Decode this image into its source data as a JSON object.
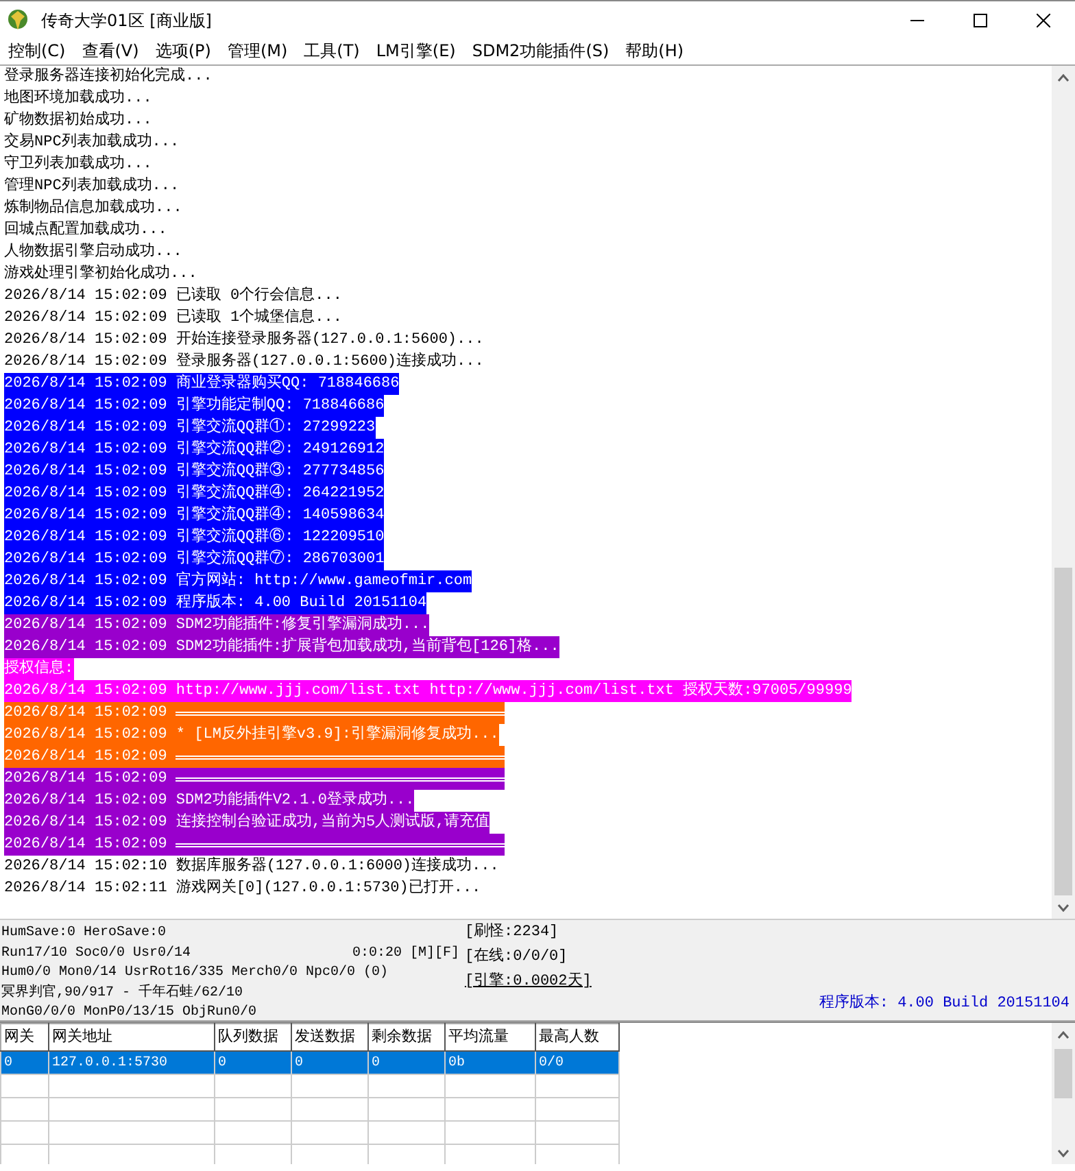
{
  "window": {
    "title": "传奇大学01区 [商业版]"
  },
  "menu": [
    {
      "label": "控制(C)"
    },
    {
      "label": "查看(V)"
    },
    {
      "label": "选项(P)"
    },
    {
      "label": "管理(M)"
    },
    {
      "label": "工具(T)"
    },
    {
      "label": "LM引擎(E)"
    },
    {
      "label": "SDM2功能插件(S)"
    },
    {
      "label": "帮助(H)"
    }
  ],
  "log": {
    "lines": [
      {
        "kind": "text",
        "text": "登录服务器连接初始化完成..."
      },
      {
        "kind": "text",
        "text": "地图环境加载成功..."
      },
      {
        "kind": "text",
        "text": "矿物数据初始成功..."
      },
      {
        "kind": "text",
        "text": "交易NPC列表加载成功..."
      },
      {
        "kind": "text",
        "text": "守卫列表加载成功..."
      },
      {
        "kind": "text",
        "text": "管理NPC列表加载成功..."
      },
      {
        "kind": "text",
        "text": "炼制物品信息加载成功..."
      },
      {
        "kind": "text",
        "text": "回城点配置加载成功..."
      },
      {
        "kind": "text",
        "text": "人物数据引擎启动成功..."
      },
      {
        "kind": "text",
        "text": "游戏处理引擎初始化成功..."
      },
      {
        "kind": "text",
        "text": "2026/8/14 15:02:09 已读取 0个行会信息..."
      },
      {
        "kind": "text",
        "text": "2026/8/14 15:02:09 已读取 1个城堡信息..."
      },
      {
        "kind": "text",
        "text": "2026/8/14 15:02:09 开始连接登录服务器(127.0.0.1:5600)..."
      },
      {
        "kind": "text",
        "text": "2026/8/14 15:02:09 登录服务器(127.0.0.1:5600)连接成功..."
      },
      {
        "kind": "text",
        "color": "#0000ff",
        "text": "2026/8/14 15:02:09 商业登录器购买QQ: 718846686"
      },
      {
        "kind": "text",
        "color": "#0000ff",
        "text": "2026/8/14 15:02:09 引擎功能定制QQ: 718846686"
      },
      {
        "kind": "text",
        "color": "#0000ff",
        "text": "2026/8/14 15:02:09 引擎交流QQ群①: 27299223"
      },
      {
        "kind": "text",
        "color": "#0000ff",
        "text": "2026/8/14 15:02:09 引擎交流QQ群②: 249126912"
      },
      {
        "kind": "text",
        "color": "#0000ff",
        "text": "2026/8/14 15:02:09 引擎交流QQ群③: 277734856"
      },
      {
        "kind": "text",
        "color": "#0000ff",
        "text": "2026/8/14 15:02:09 引擎交流QQ群④: 264221952"
      },
      {
        "kind": "text",
        "color": "#0000ff",
        "text": "2026/8/14 15:02:09 引擎交流QQ群④: 140598634"
      },
      {
        "kind": "text",
        "color": "#0000ff",
        "text": "2026/8/14 15:02:09 引擎交流QQ群⑥: 122209510"
      },
      {
        "kind": "text",
        "color": "#0000ff",
        "text": "2026/8/14 15:02:09 引擎交流QQ群⑦: 286703001"
      },
      {
        "kind": "text",
        "color": "#0000ff",
        "text": "2026/8/14 15:02:09 官方网站: http://www.gameofmir.com"
      },
      {
        "kind": "text",
        "color": "#0000ff",
        "text": "2026/8/14 15:02:09 程序版本: 4.00 Build 20151104"
      },
      {
        "kind": "text",
        "color": "#9900cc",
        "text": "2026/8/14 15:02:09 SDM2功能插件:修复引擎漏洞成功..."
      },
      {
        "kind": "text",
        "color": "#9900cc",
        "text": "2026/8/14 15:02:09 SDM2功能插件:扩展背包加载成功,当前背包[126]格..."
      },
      {
        "kind": "text",
        "color": "#ff00ff",
        "text": "授权信息:"
      },
      {
        "kind": "text",
        "color": "#ff00ff",
        "text": "2026/8/14 15:02:09 http://www.jjj.com/list.txt http://www.jjj.com/list.txt 授权天数:97005/99999"
      },
      {
        "kind": "rule",
        "color": "#ff6600",
        "text": "2026/8/14 15:02:09"
      },
      {
        "kind": "text",
        "color": "#ff6600",
        "text": "2026/8/14 15:02:09 * [LM反外挂引擎v3.9]:引擎漏洞修复成功..."
      },
      {
        "kind": "rule",
        "color": "#ff6600",
        "text": "2026/8/14 15:02:09"
      },
      {
        "kind": "rule",
        "color": "#9900cc",
        "text": "2026/8/14 15:02:09"
      },
      {
        "kind": "text",
        "color": "#9900cc",
        "text": "2026/8/14 15:02:09 SDM2功能插件V2.1.0登录成功..."
      },
      {
        "kind": "text",
        "color": "#9900cc",
        "text": "2026/8/14 15:02:09 连接控制台验证成功,当前为5人测试版,请充值"
      },
      {
        "kind": "rule",
        "color": "#9900cc",
        "text": "2026/8/14 15:02:09"
      },
      {
        "kind": "text",
        "text": "2026/8/14 15:02:10 数据库服务器(127.0.0.1:6000)连接成功..."
      },
      {
        "kind": "text",
        "text": "2026/8/14 15:02:11 游戏网关[0](127.0.0.1:5730)已打开..."
      }
    ]
  },
  "status": {
    "lines": [
      "HumSave:0 HeroSave:0",
      "Run17/10 Soc0/0 Usr0/14",
      "Hum0/0 Mon0/14 UsrRot16/335 Merch0/0 Npc0/0 (0)",
      "冥界判官,90/917 - 千年石蛙/62/10",
      "MonG0/0/0 MonP0/13/15 ObjRun0/0"
    ],
    "timer": "0:0:20 [M][F]",
    "counters": [
      {
        "kind": "text",
        "text": "[刷怪:2234]"
      },
      {
        "kind": "text",
        "text": "[在线:0/0/0]"
      },
      {
        "kind": "link",
        "text": "[引擎:0.0002天]"
      }
    ],
    "version": "程序版本: 4.00 Build 20151104"
  },
  "table": {
    "columns": [
      "网关",
      "网关地址",
      "队列数据",
      "发送数据",
      "剩余数据",
      "平均流量",
      "最高人数"
    ],
    "rows": [
      {
        "selected": true,
        "cells": [
          "0",
          "127.0.0.1:5730",
          "0",
          "0",
          "0",
          "0b",
          "0/0"
        ]
      }
    ]
  }
}
